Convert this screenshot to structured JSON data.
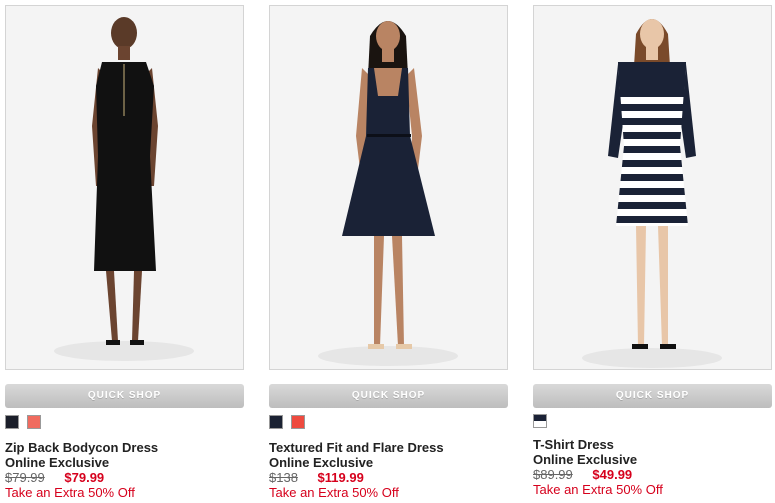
{
  "products": [
    {
      "name": "Zip Back Bodycon Dress",
      "badge": "Online Exclusive",
      "old_price": "$79.99",
      "price": "$79.99",
      "promo": "Take an Extra 50% Off",
      "quick_shop": "QUICK SHOP",
      "swatches": [
        "#1b1f2a",
        "#f06b5f"
      ]
    },
    {
      "name": "Textured Fit and Flare Dress",
      "badge": "Online Exclusive",
      "old_price": "$138",
      "price": "$119.99",
      "promo": "Take an Extra 50% Off",
      "quick_shop": "QUICK SHOP",
      "swatches": [
        "#1b2233",
        "#ee4a3f"
      ]
    },
    {
      "name": "T-Shirt Dress",
      "badge": "Online Exclusive",
      "old_price": "$89.99",
      "price": "$49.99",
      "promo": "Take an Extra 50% Off",
      "quick_shop": "QUICK SHOP",
      "swatches": [
        "navy-white-stripe"
      ]
    }
  ],
  "colors": {
    "sale_red": "#d6001c",
    "button_gray": "#c8c8c8"
  }
}
